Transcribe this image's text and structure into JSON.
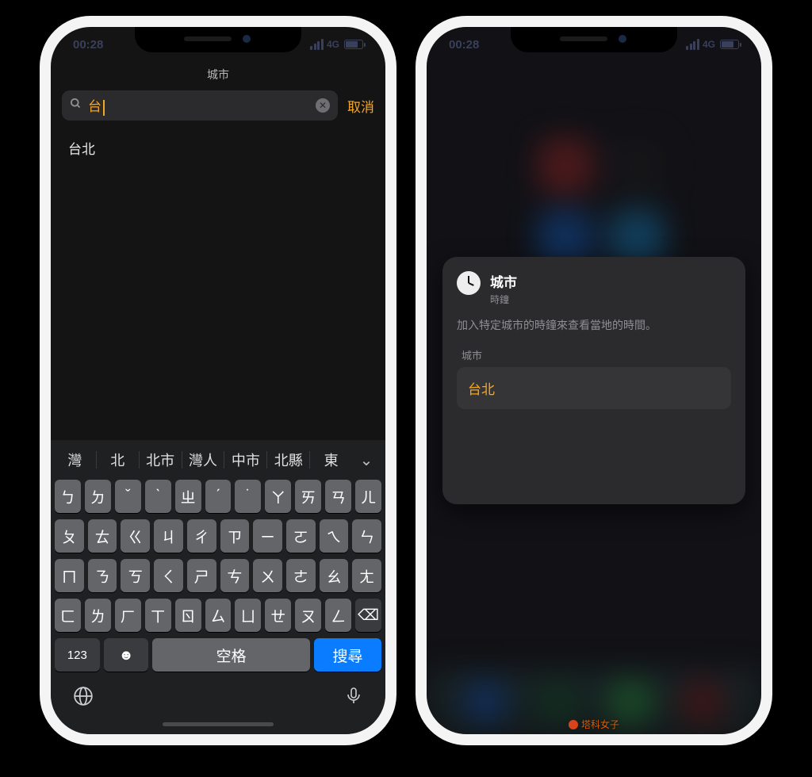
{
  "status": {
    "time": "00:28",
    "network": "4G"
  },
  "left": {
    "title": "城市",
    "search": {
      "value": "台",
      "cancel": "取消"
    },
    "results": [
      "台北"
    ],
    "suggestions": [
      "灣",
      "北",
      "北市",
      "灣人",
      "中市",
      "北縣",
      "東"
    ],
    "keyboard": {
      "rows": [
        [
          "ㄅ",
          "ㄉ",
          "ˇ",
          "ˋ",
          "ㄓ",
          "ˊ",
          "˙",
          "ㄚ",
          "ㄞ",
          "ㄢ",
          "ㄦ"
        ],
        [
          "ㄆ",
          "ㄊ",
          "ㄍ",
          "ㄐ",
          "ㄔ",
          "ㄗ",
          "ㄧ",
          "ㄛ",
          "ㄟ",
          "ㄣ"
        ],
        [
          "ㄇ",
          "ㄋ",
          "ㄎ",
          "ㄑ",
          "ㄕ",
          "ㄘ",
          "ㄨ",
          "ㄜ",
          "ㄠ",
          "ㄤ"
        ],
        [
          "ㄈ",
          "ㄌ",
          "ㄏ",
          "ㄒ",
          "ㄖ",
          "ㄙ",
          "ㄩ",
          "ㄝ",
          "ㄡ",
          "ㄥ"
        ]
      ],
      "numeric": "123",
      "space": "空格",
      "search": "搜尋"
    }
  },
  "right": {
    "card": {
      "title": "城市",
      "subtitle": "時鐘",
      "description": "加入特定城市的時鐘來查看當地的時間。",
      "field_label": "城市",
      "field_value": "台北"
    }
  },
  "watermark": "塔科女子"
}
